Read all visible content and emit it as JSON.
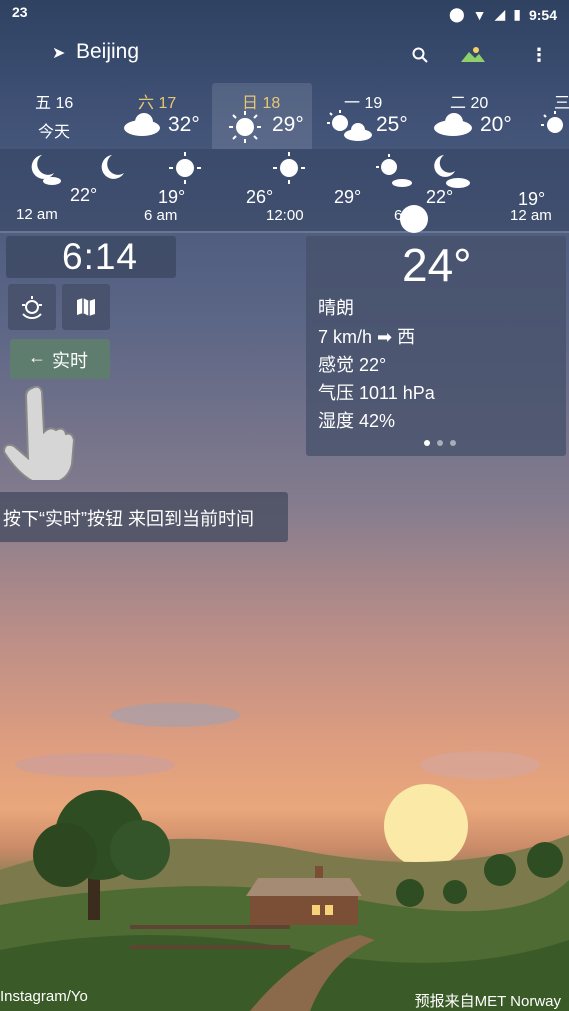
{
  "status": {
    "left_number": "23",
    "time": "9:54"
  },
  "toolbar": {
    "city": "Beijing"
  },
  "daily": [
    {
      "day": "五 16",
      "sub": "今天",
      "temp": ""
    },
    {
      "day": "六 17",
      "sub": "",
      "temp": "32°"
    },
    {
      "day": "日 18",
      "sub": "",
      "temp": "29°"
    },
    {
      "day": "一 19",
      "sub": "",
      "temp": "25°"
    },
    {
      "day": "二 20",
      "sub": "",
      "temp": "20°"
    },
    {
      "day": "三",
      "sub": "",
      "temp": ""
    }
  ],
  "hourly": {
    "temps": [
      "22°",
      "19°",
      "26°",
      "29°",
      "22°",
      "19°"
    ],
    "times": [
      "12 am",
      "6 am",
      "12:00",
      "6",
      "12 am"
    ]
  },
  "panel": {
    "time": "6:14",
    "live_label": "实时",
    "tip": "按下“实时”按钮 来回到当前时间"
  },
  "current": {
    "temp": "24°",
    "condition": "晴朗",
    "wind_speed": "7 km/h",
    "wind_dir": "西",
    "feels": "感觉 22°",
    "pressure": "气压 1011 hPa",
    "humidity": "湿度 42%"
  },
  "footer": {
    "left": "Instagram/Yo",
    "right": "预报来自MET Norway"
  },
  "colors": {
    "selected_day": "#e8c774",
    "live_button": "#5e7d6e"
  }
}
